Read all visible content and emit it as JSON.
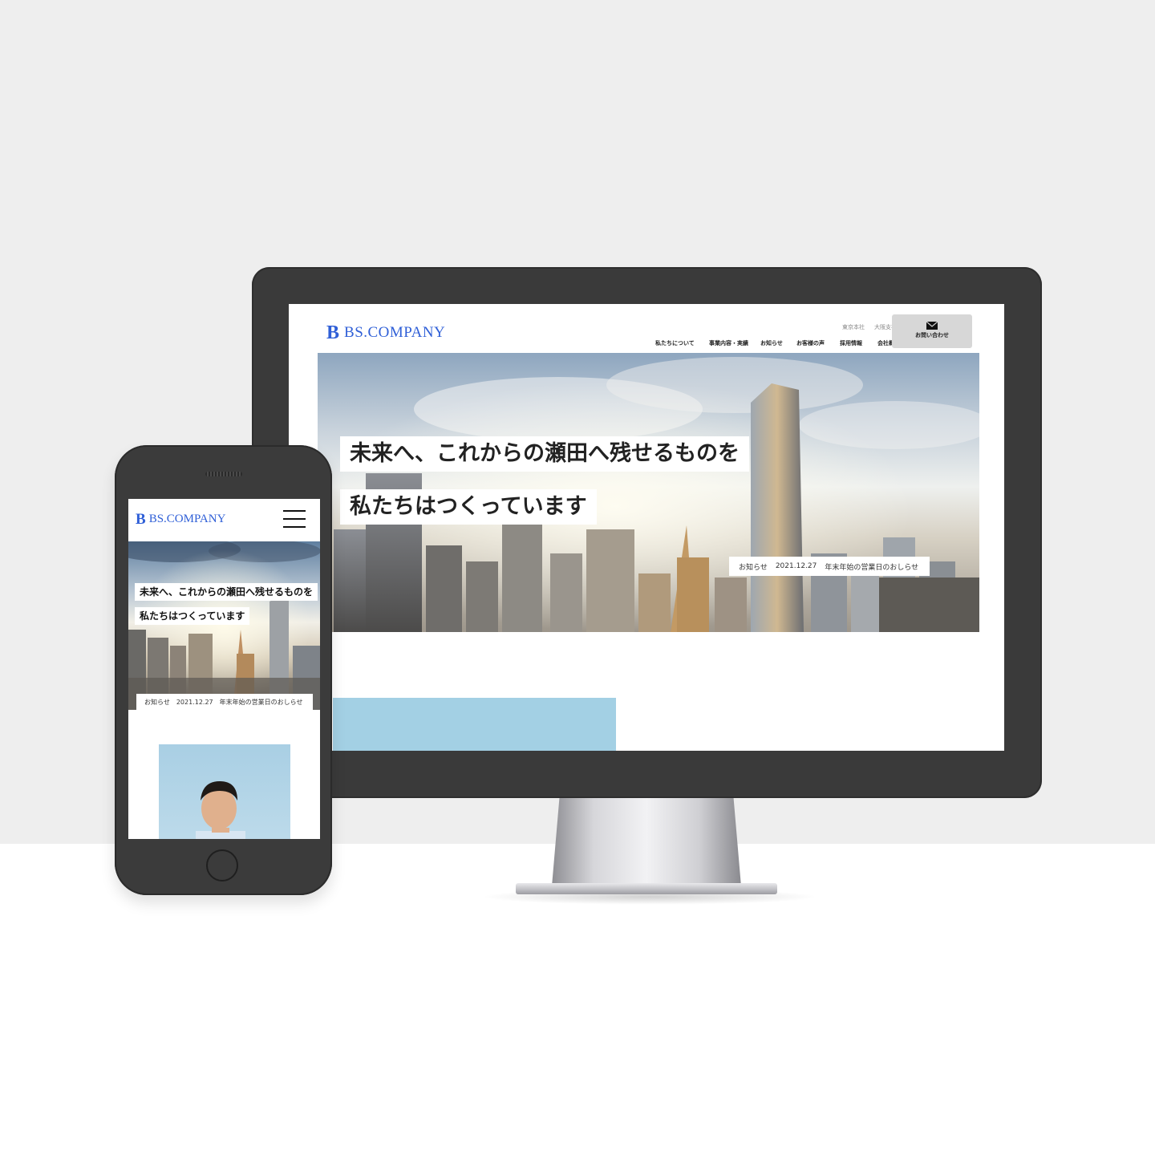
{
  "colors": {
    "brand_blue": "#2f5fd7",
    "device_frame": "#3a3a3a",
    "background_top": "#eeeeee",
    "accent_panel": "#a3d0e4",
    "contact_button_bg": "#d7d7d7"
  },
  "desktop": {
    "logo_mark": "B",
    "logo_text": "BS.COMPANY",
    "top_links": [
      "東京本社",
      "大阪支社"
    ],
    "nav": [
      "私たちについて",
      "事業内容・実績",
      "お知らせ",
      "お客様の声",
      "採用情報",
      "会社概要"
    ],
    "contact": {
      "icon": "envelope-icon",
      "label": "お問い合わせ"
    },
    "hero": {
      "headline_line1": "未来へ、これからの瀬田へ残せるものを",
      "headline_line2": "私たちはつくっています"
    },
    "news": {
      "label": "お知らせ",
      "date": "2021.12.27",
      "title": "年末年始の営業日のおしらせ"
    }
  },
  "mobile": {
    "logo_mark": "B",
    "logo_text": "BS.COMPANY",
    "menu_icon": "hamburger-icon",
    "hero": {
      "headline_line1": "未来へ、これからの瀬田へ残せるものを",
      "headline_line2": "私たちはつくっています"
    },
    "news": {
      "label": "お知らせ",
      "date": "2021.12.27",
      "title": "年末年始の営業日のおしらせ"
    }
  }
}
